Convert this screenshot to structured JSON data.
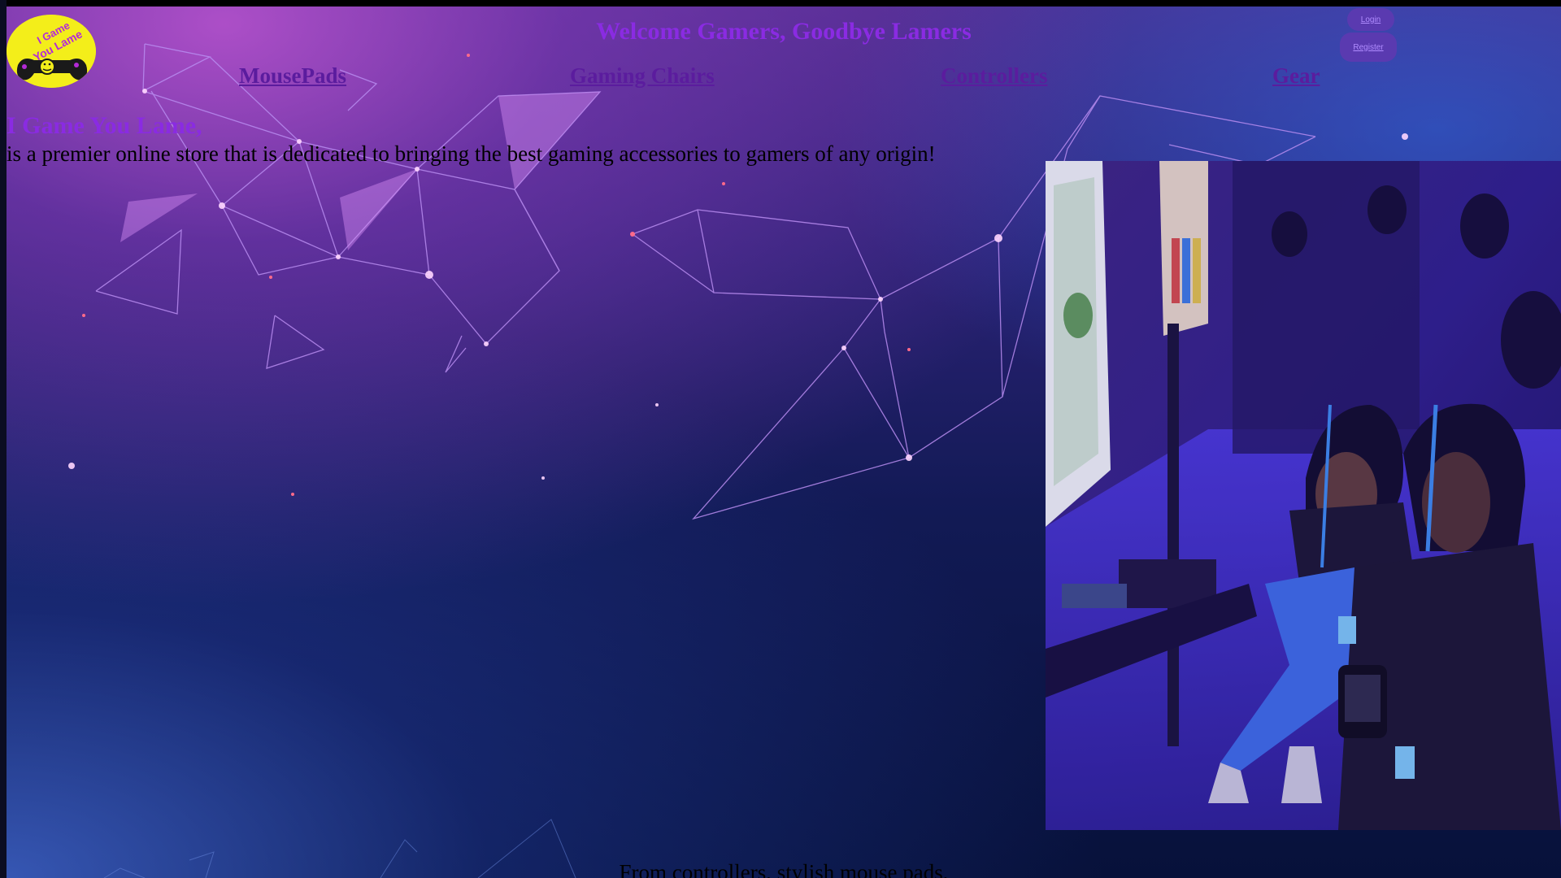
{
  "header": {
    "title": "Welcome Gamers, Goodbye Lamers",
    "logo_text_line1": "I Game",
    "logo_text_line2": "You Lame"
  },
  "nav": {
    "items": [
      {
        "label": "MousePads"
      },
      {
        "label": "Gaming Chairs"
      },
      {
        "label": "Controllers"
      },
      {
        "label": "Gear"
      }
    ]
  },
  "auth": {
    "login_label": "Login",
    "register_label": "Register"
  },
  "intro": {
    "heading": "I Game You Lame,",
    "text": "is a premier online store that is dedicated to bringing the best gaming accessories to gamers of any origin!"
  },
  "footer_text": "From controllers, stylish mouse pads,",
  "colors": {
    "accent": "#8a2be2",
    "nav_link": "#5b1c9e",
    "logo_bg": "#f3ee1a",
    "button_bg": "#5a3ab0"
  }
}
